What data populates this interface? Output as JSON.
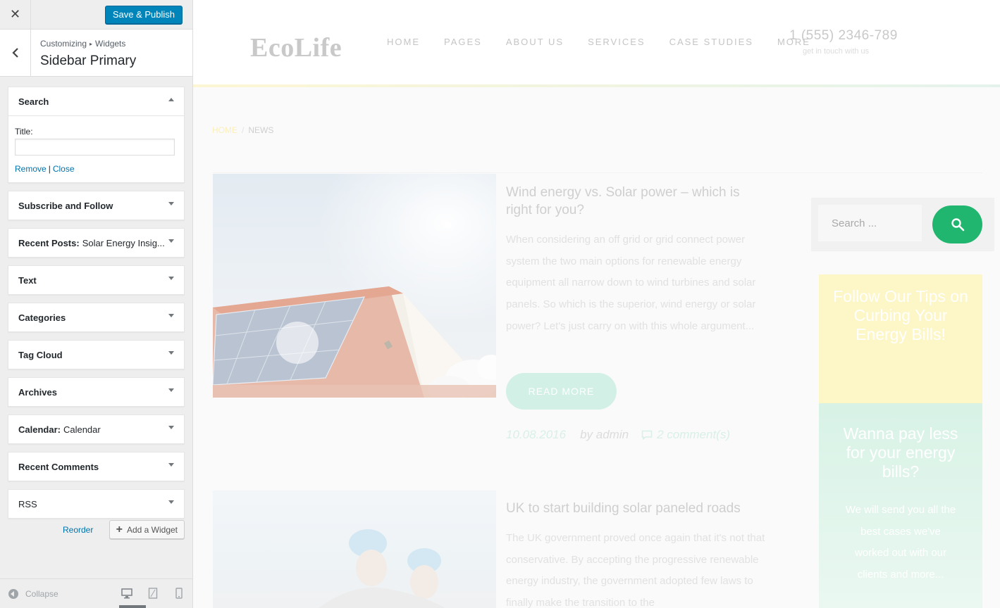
{
  "customizer": {
    "close_glyph": "✕",
    "save_label": "Save & Publish",
    "breadcrumb": {
      "root": "Customizing",
      "sep": "▸",
      "parent": "Widgets"
    },
    "section_title": "Sidebar Primary",
    "widgets": [
      {
        "title": "Search",
        "sub": "",
        "expanded": true,
        "field_label": "Title:",
        "field_value": "",
        "remove_label": "Remove",
        "sep": "|",
        "close_label": "Close"
      },
      {
        "title": "Subscribe and Follow",
        "sub": ""
      },
      {
        "title": "Recent Posts:",
        "sub": "Solar Energy Insig..."
      },
      {
        "title": "Text",
        "sub": ""
      },
      {
        "title": "Categories",
        "sub": ""
      },
      {
        "title": "Tag Cloud",
        "sub": ""
      },
      {
        "title": "Archives",
        "sub": ""
      },
      {
        "title": "Calendar:",
        "sub": "Calendar"
      },
      {
        "title": "Recent Comments",
        "sub": ""
      },
      {
        "title": "RSS",
        "sub": ""
      }
    ],
    "reorder_label": "Reorder",
    "add_widget_label": "Add a Widget",
    "collapse_label": "Collapse",
    "devices": [
      "desktop-icon",
      "tablet-icon",
      "mobile-icon"
    ],
    "active_device": "desktop"
  },
  "site": {
    "logo": "EcoLife",
    "nav": [
      "HOME",
      "PAGES",
      "ABOUT US",
      "SERVICES",
      "CASE STUDIES",
      "MORE"
    ],
    "phone": "1 (555) 2346-789",
    "phone_sub": "get in touch with us",
    "breadcrumb": {
      "home": "HOME",
      "sep": "/",
      "current": "NEWS"
    },
    "posts": [
      {
        "title": "Wind energy vs. Solar power – which is right for you?",
        "excerpt": "When considering an off grid or grid connect power system the two main options for renewable energy equipment all narrow down to wind turbines and solar panels. So which is the superior, wind energy or solar power? Let's just carry on with this whole argument...",
        "read_more": "READ MORE",
        "date": "10.08.2016",
        "author": "by admin",
        "comments": "2 comment(s)"
      },
      {
        "title": "UK to start building solar paneled roads",
        "excerpt": "The UK government proved once again that it's not that conservative. By accepting the progressive renewable energy industry, the government adopted few laws to finally make the transition to the"
      }
    ],
    "search_placeholder": "Search ...",
    "promo1": "Follow Our Tips on Curbing Your Energy Bills!",
    "promo2_title": "Wanna pay less for your energy bills?",
    "promo2_text": "We will send you all the best cases we've worked out with our clients and more..."
  },
  "colors": {
    "primary_button": "#0085ba",
    "link": "#0073aa",
    "accent_green": "#20b66f",
    "promo_yellow": "#fdf6c6",
    "promo_green": "#d8f2e6"
  }
}
